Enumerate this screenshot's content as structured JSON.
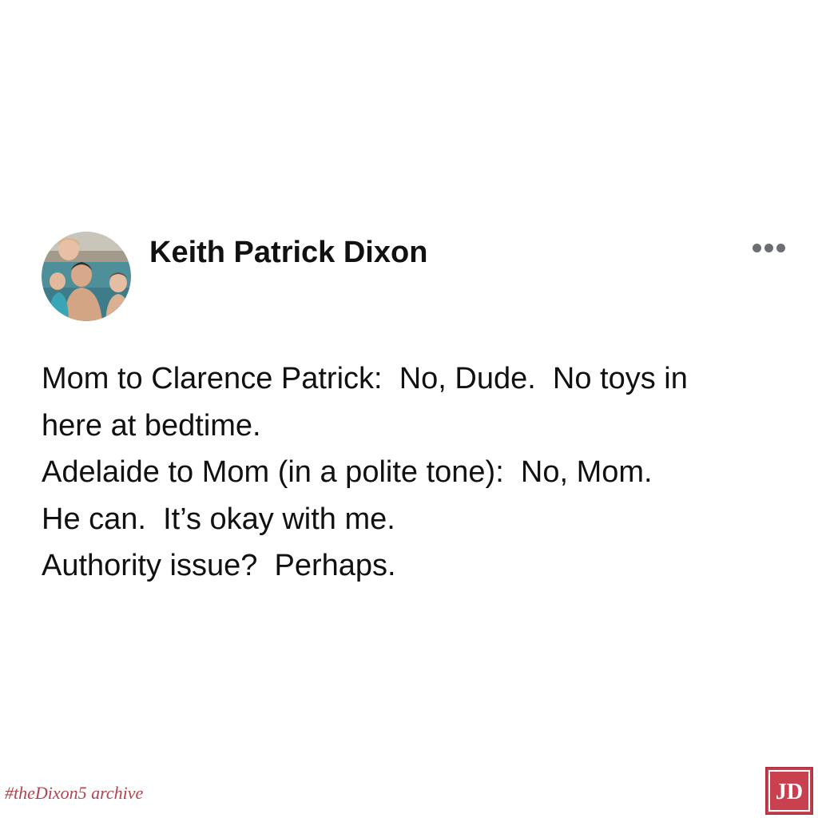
{
  "post": {
    "author": "Keith Patrick Dixon",
    "avatar_icon": "family-photo-avatar",
    "more_icon": "more-horizontal-icon",
    "lines": [
      "Mom to Clarence Patrick:  No, Dude.  No toys in",
      "here at bedtime.",
      "Adelaide to Mom (in a polite tone):  No, Mom.",
      "He can.  It’s okay with me.",
      "Authority issue?  Perhaps."
    ]
  },
  "footer": {
    "watermark": "#theDixon5 archive",
    "logo_text": "JD",
    "accent_color": "#c9404f"
  }
}
